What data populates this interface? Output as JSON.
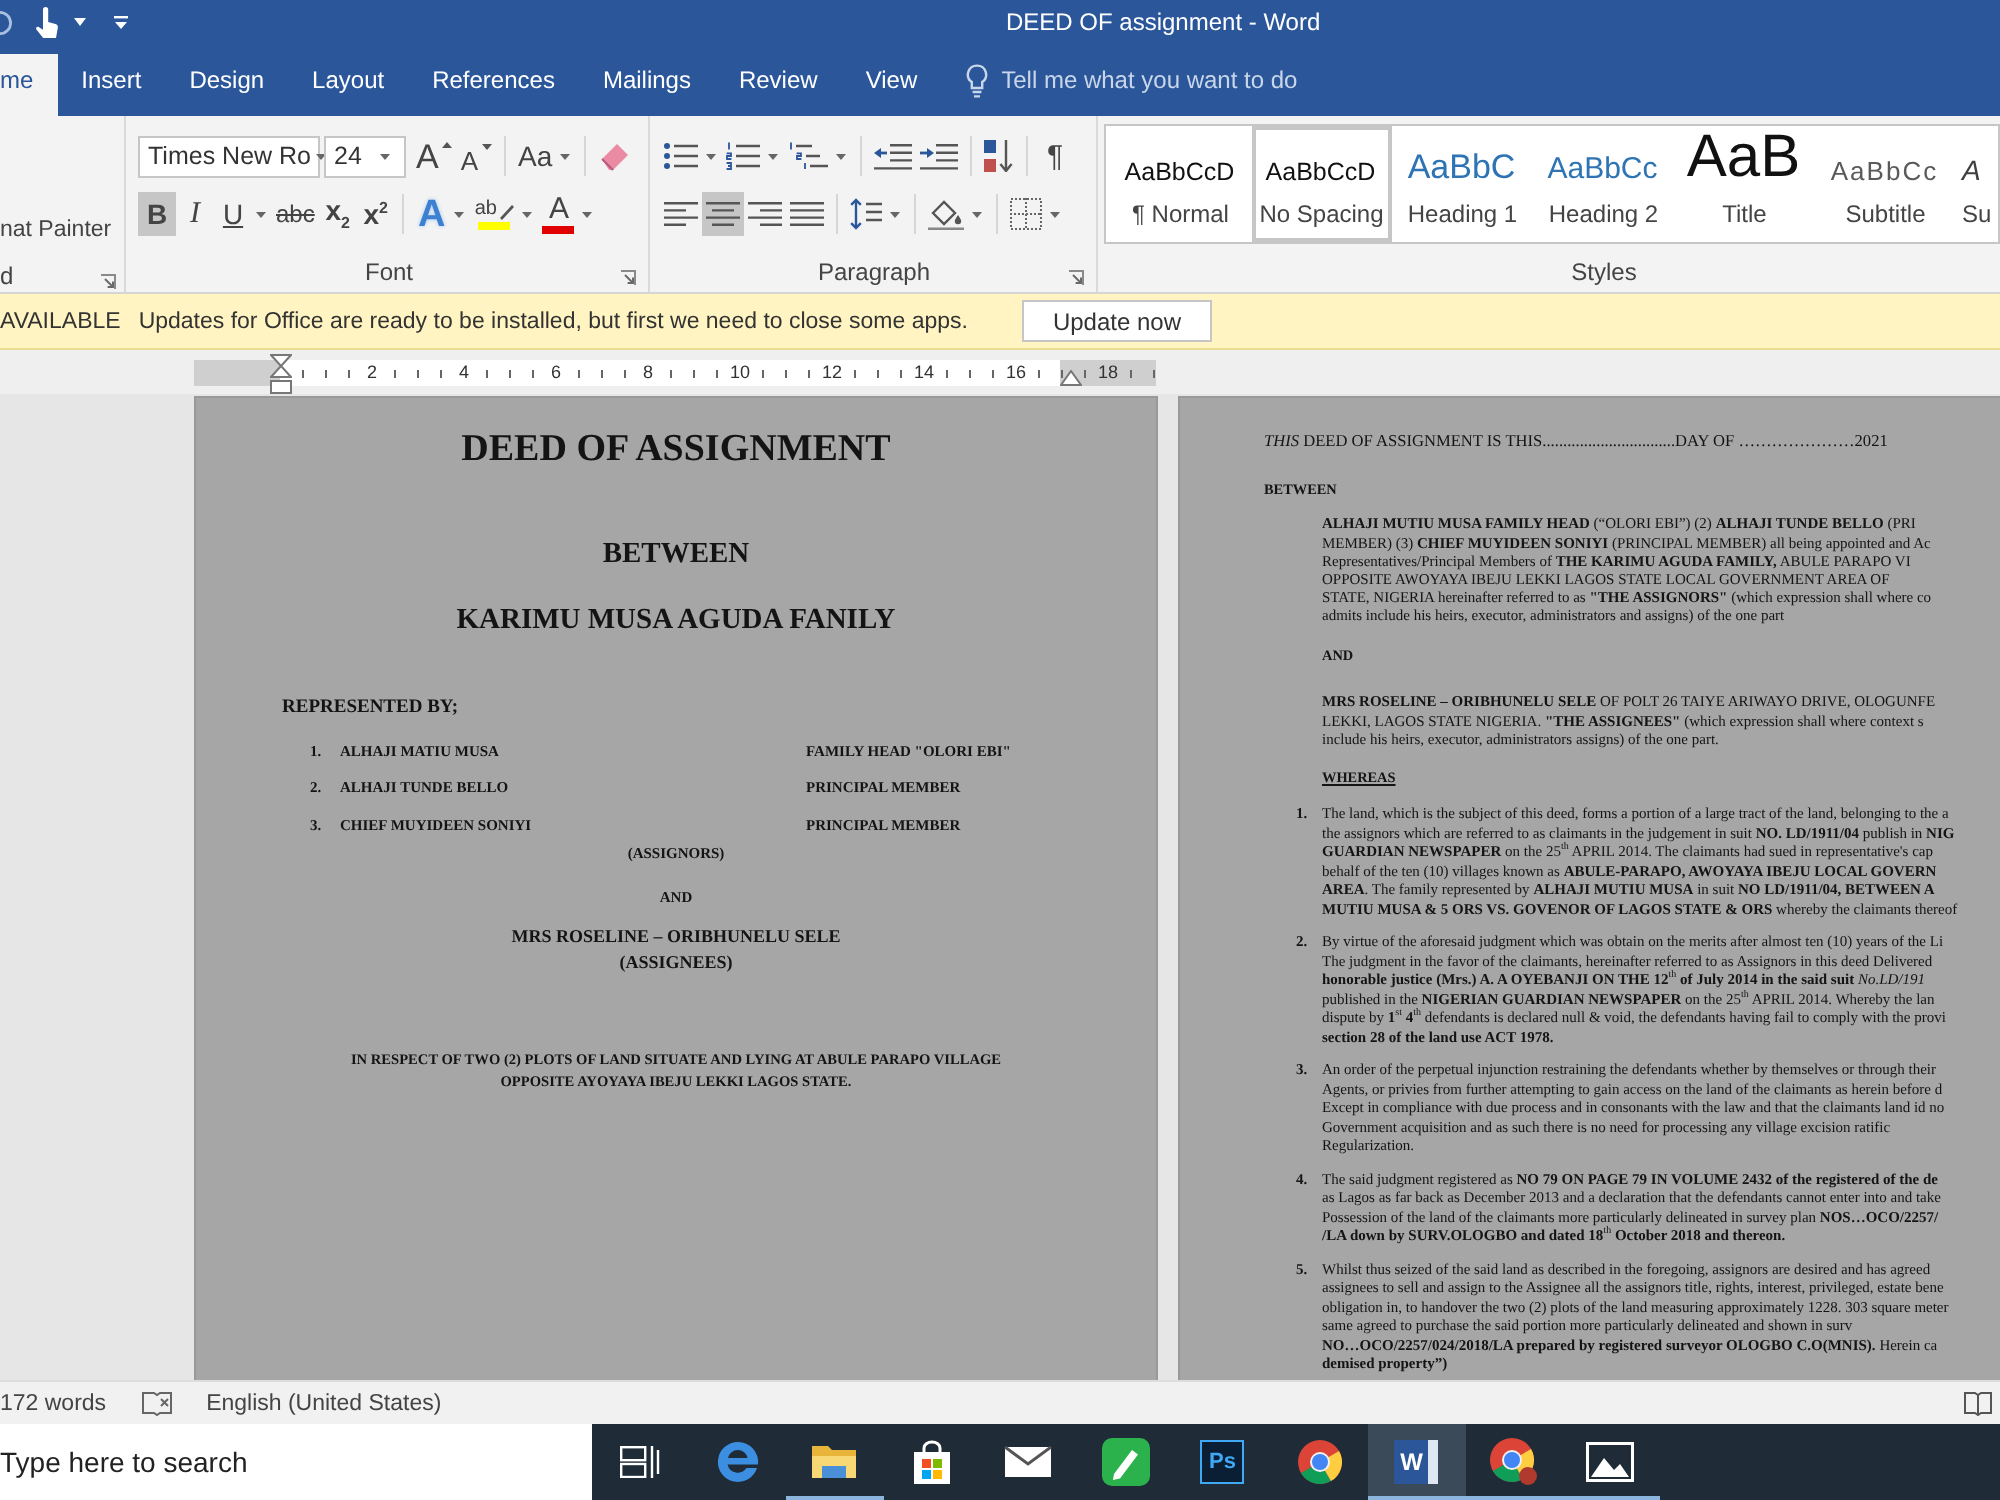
{
  "title_bar": {
    "title": "DEED OF assignment - Word"
  },
  "tabs": [
    {
      "label": "me",
      "selected": true
    },
    {
      "label": "Insert",
      "selected": false
    },
    {
      "label": "Design",
      "selected": false
    },
    {
      "label": "Layout",
      "selected": false
    },
    {
      "label": "References",
      "selected": false
    },
    {
      "label": "Mailings",
      "selected": false
    },
    {
      "label": "Review",
      "selected": false
    },
    {
      "label": "View",
      "selected": false
    }
  ],
  "tell_me": {
    "placeholder": "Tell me what you want to do"
  },
  "ribbon": {
    "clipboard": {
      "format_painter": "nat Painter",
      "label": "d"
    },
    "font": {
      "font_name": "Times New Ro",
      "font_size": "24",
      "size_tools": [
        {
          "kind": "grow",
          "glyph": "A"
        },
        {
          "kind": "shrink",
          "glyph": "A"
        },
        {
          "kind": "change_case",
          "glyph": "Aa"
        },
        {
          "kind": "clear_formatting"
        }
      ],
      "toggles": [
        {
          "kind": "bold",
          "glyph": "B",
          "on": true
        },
        {
          "kind": "italic",
          "glyph": "I",
          "on": false
        },
        {
          "kind": "underline",
          "glyph": "U",
          "on": false
        },
        {
          "kind": "strikethrough",
          "glyph": "abc",
          "on": false
        },
        {
          "kind": "subscript",
          "glyph": "x$_{2}$",
          "on": false
        },
        {
          "kind": "superscript",
          "glyph": "x$^{2}$",
          "on": false
        }
      ],
      "color_tools": [
        {
          "kind": "text_effects",
          "glyph": "A"
        },
        {
          "kind": "highlight",
          "glyph": "ab",
          "color": "#ffff00"
        },
        {
          "kind": "font_color",
          "glyph": "A",
          "color": "#e00000"
        }
      ],
      "label": "Font"
    },
    "paragraph": {
      "list_tools": [
        {
          "kind": "bullets"
        },
        {
          "kind": "numbering"
        },
        {
          "kind": "multilevel"
        },
        {
          "kind": "decrease_indent"
        },
        {
          "kind": "increase_indent"
        },
        {
          "kind": "sort"
        }
      ],
      "show_marks": {
        "glyph": "¶",
        "on": false
      },
      "alignment": [
        {
          "kind": "left",
          "selected": false
        },
        {
          "kind": "center",
          "selected": true
        },
        {
          "kind": "right",
          "selected": false
        },
        {
          "kind": "justify",
          "selected": false
        }
      ],
      "spacing_tools": [
        {
          "kind": "line_spacing"
        },
        {
          "kind": "shading"
        },
        {
          "kind": "borders"
        }
      ],
      "label": "Paragraph"
    },
    "styles": {
      "items": [
        {
          "sample": "AaBbCcD",
          "name": "¶ Normal",
          "kind": "normal",
          "selected": false
        },
        {
          "sample": "AaBbCcD",
          "name": "No Spacing",
          "kind": "normal",
          "selected": true
        },
        {
          "sample": "AaBbC",
          "name": "Heading 1",
          "kind": "heading_1",
          "selected": false
        },
        {
          "sample": "AaBbCc",
          "name": "Heading 2",
          "kind": "heading_2",
          "selected": false
        },
        {
          "sample": "AaB",
          "name": "Title",
          "kind": "title",
          "selected": false
        },
        {
          "sample": "AaBbCc",
          "name": "Subtitle",
          "kind": "subtitle",
          "selected": false
        },
        {
          "sample": "A",
          "name": "Su",
          "kind": "emphasis",
          "selected": false
        }
      ],
      "label": "Styles"
    }
  },
  "update_bar": {
    "label": "AVAILABLE",
    "message": "Updates for Office are ready to be installed, but first we need to close some apps.",
    "button": "Update now"
  },
  "ruler": {
    "numbers": [
      "2",
      "4",
      "6",
      "8",
      "10",
      "12",
      "14",
      "16",
      "18"
    ]
  },
  "left_page": {
    "title": "DEED OF ASSIGNMENT",
    "between": "BETWEEN",
    "family": "KARIMU MUSA AGUDA FANILY",
    "represented_by": "REPRESENTED BY;",
    "representatives": [
      {
        "number": "1.",
        "name": "ALHAJI MATIU MUSA",
        "role": "FAMILY HEAD \"OLORI EBI\""
      },
      {
        "number": "2.",
        "name": "ALHAJI TUNDE BELLO",
        "role": "PRINCIPAL MEMBER"
      },
      {
        "number": "3.",
        "name": "CHIEF MUYIDEEN SONIYI",
        "role": "PRINCIPAL MEMBER"
      }
    ],
    "assignors": "(ASSIGNORS)",
    "and": "AND",
    "assignee": "MRS ROSELINE – ORIBHUNELU SELE",
    "assignees": "(ASSIGNEES)",
    "respect_lines": [
      "IN RESPECT OF TWO (2) PLOTS OF LAND SITUATE AND LYING AT ABULE PARAPO VILLAGE",
      "OPPOSITE AYOYAYA IBEJU LEKKI LAGOS STATE."
    ]
  },
  "right_page": {
    "date_line": "*THIS* DEED OF ASSIGNMENT IS THIS................................DAY OF …………………2021",
    "between": "BETWEEN",
    "assignor_lines": [
      "**ALHAJI MUTIU MUSA FAMILY HEAD** (“OLORI EBI”) (2) **ALHAJI TUNDE BELLO** (PRI",
      "MEMBER) (3) **CHIEF MUYIDEEN SONIYI** (PRINCIPAL MEMBER) all being appointed and Ac",
      "Representatives/Principal Members of **THE KARIMU AGUDA FAMILY,** ABULE PARAPO VI",
      "OPPOSITE AWOYAYA IBEJU LEKKI LAGOS STATE LOCAL GOVERNMENT AREA OF",
      "STATE, NIGERIA hereinafter referred to as **\"THE ASSIGNORS\"** (which expression shall where co",
      "admits include his heirs, executor, administrators and assigns) of the one part"
    ],
    "and": "AND",
    "assignee_lines": [
      "**MRS ROSELINE – ORIBHUNELU SELE** OF POLT 26 TAIYE ARIWAYO DRIVE, OLOGUNFE",
      "LEKKI, LAGOS STATE NIGERIA. **\"THE ASSIGNEES\"** (which expression shall where context s",
      "include his heirs, executor, administrators assigns) of the one part."
    ],
    "whereas": "WHEREAS",
    "clauses": [
      {
        "number": "1.",
        "lines": [
          "The land, which is the subject of this deed, forms a portion of a large tract of the land, belonging to the a",
          "the assignors which are referred to as claimants in the judgement in suit **NO. LD/1911/04** publish in **NIG**",
          "**GUARDIAN NEWSPAPER** on the 25$^{th}$ APRIL 2014. The claimants had sued in representative's cap",
          "behalf of the ten (10) villages known as **ABULE-PARAPO, AWOYAYA IBEJU LOCAL GOVERN**",
          "**AREA**. The family represented by **ALHAJI MUTIU MUSA** in suit **NO LD/1911/04, BETWEEN A**",
          "**MUTIU MUSA & 5 ORS VS. GOVENOR OF LAGOS STATE & ORS** whereby the claimants thereof"
        ]
      },
      {
        "number": "2.",
        "lines": [
          "By virtue of the aforesaid judgment which was obtain on the merits after almost ten (10) years of the Li",
          "The judgment in the favor of the claimants, hereinafter referred to as Assignors in this deed Delivered",
          "**honorable justice (Mrs.) A. A OYEBANJI ON THE 12**$^{th}$ **of July 2014 in the said suit** *No.LD/191*",
          "published in the **NIGERIAN GUARDIAN NEWSPAPER** on the 25$^{th}$ APRIL 2014. Whereby the lan",
          "dispute by **1**$^{st}$ **4**$^{th}$ defendants is declared null & void, the defendants having fail to comply with the provi",
          "**section 28 of the land use ACT 1978.**"
        ]
      },
      {
        "number": "3.",
        "lines": [
          "An order of the perpetual injunction restraining the defendants whether by themselves or through their",
          "Agents, or privies from further attempting to gain access on the land of the claimants as herein before d",
          "Except in compliance with due process and in consonants with the law and that the claimants land id no",
          "Government acquisition and as such there is no need for processing any village excision ratific",
          "Regularization."
        ]
      },
      {
        "number": "4.",
        "lines": [
          "The said judgment registered as **NO 79 ON PAGE 79 IN VOLUME 2432 of the registered of the de**",
          "as Lagos as far back as December 2013 and a declaration that the defendants cannot enter into and take",
          "Possession of the land of the claimants more particularly delineated in survey plan **NOS…OCO/2257/**",
          "**/LA down by SURV.OLOGBO and dated 18**$^{th}$ **October 2018 and thereon.**"
        ]
      },
      {
        "number": "5.",
        "lines": [
          "Whilst thus seized of the said land as described in the foregoing, assignors are desired and has agreed",
          "assignees to sell and assign to the Assignee all the assignors title, rights, interest, privileged, estate bene",
          "obligation in, to handover the two (2) plots of the land measuring approximately 1228. 303 square meter",
          "same agreed to purchase the said portion more particularly delineated and shown in surv",
          "**NO…OCO/2257/024/2018/LA prepared by registered surveyor OLOGBO C.O(MNIS).** Herein ca",
          "**demised property”)**"
        ]
      }
    ]
  },
  "status_bar": {
    "word_count": "172 words",
    "language": "English (United States)"
  },
  "taskbar": {
    "search": {
      "placeholder": "Type here to search"
    },
    "apps": [
      {
        "kind": "task_view",
        "running": false,
        "active": false
      },
      {
        "kind": "edge",
        "running": false,
        "active": false
      },
      {
        "kind": "explorer",
        "running": true,
        "active": false
      },
      {
        "kind": "store",
        "running": false,
        "active": false
      },
      {
        "kind": "mail",
        "running": false,
        "active": false
      },
      {
        "kind": "green_pen",
        "running": false,
        "active": false
      },
      {
        "kind": "ps_tile",
        "label": "Ps",
        "running": false,
        "active": false
      },
      {
        "kind": "chrome",
        "running": false,
        "active": false
      },
      {
        "kind": "word_tile",
        "label": "W",
        "running": true,
        "active": true
      },
      {
        "kind": "chrome_profile",
        "running": true,
        "active": false
      },
      {
        "kind": "photos",
        "running": true,
        "active": false
      }
    ]
  }
}
